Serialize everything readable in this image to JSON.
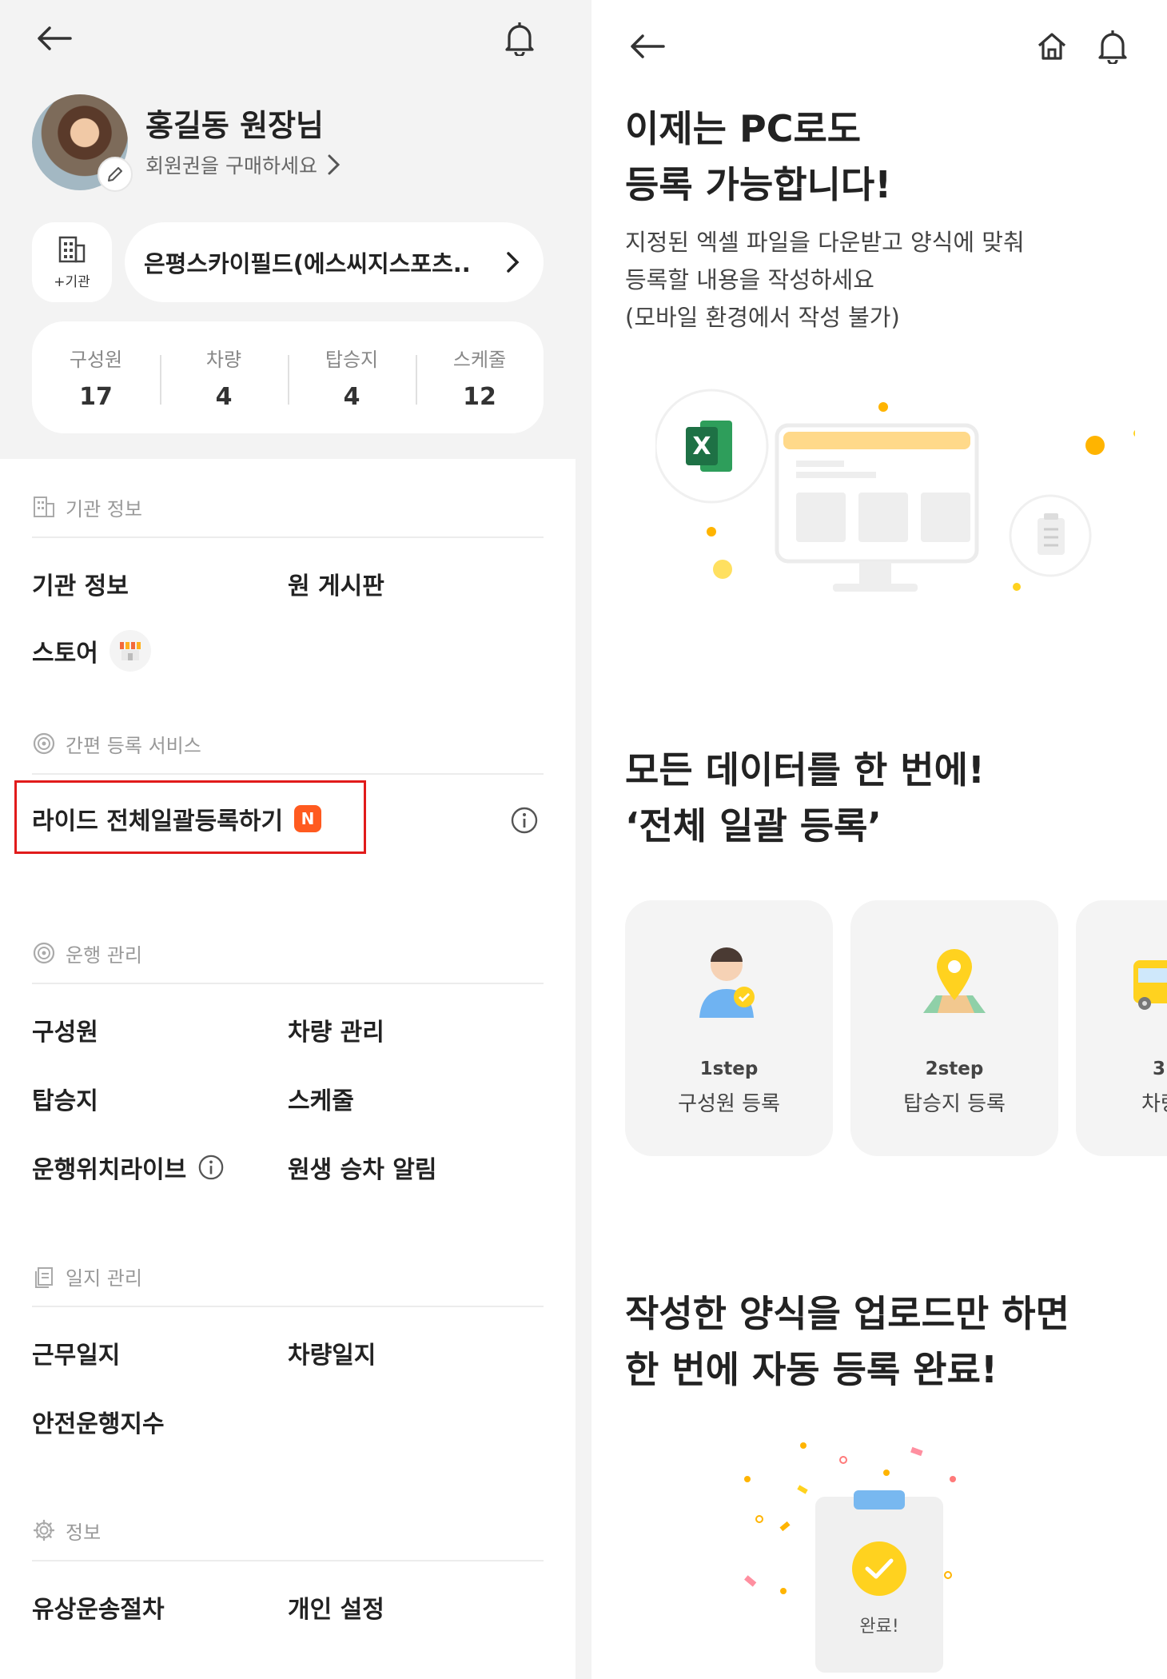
{
  "left": {
    "user": {
      "name": "홍길동 원장님",
      "subtitle": "회원권을 구매하세요"
    },
    "org": {
      "add_label": "+기관",
      "selected": "은평스카이필드(에스씨지스포츠.."
    },
    "stats": [
      {
        "label": "구성원",
        "value": "17"
      },
      {
        "label": "차량",
        "value": "4"
      },
      {
        "label": "탑승지",
        "value": "4"
      },
      {
        "label": "스케줄",
        "value": "12"
      }
    ],
    "sections": {
      "org_info": {
        "title": "기관 정보",
        "items": [
          "기관 정보",
          "원 게시판",
          "스토어"
        ]
      },
      "quick_register": {
        "title": "간편 등록 서비스",
        "item": "라이드 전체일괄등록하기",
        "badge": "N"
      },
      "operation": {
        "title": "운행 관리",
        "items": [
          "구성원",
          "차량 관리",
          "탑승지",
          "스케줄",
          "운행위치라이브",
          "원생 승차 알림"
        ]
      },
      "log": {
        "title": "일지 관리",
        "items": [
          "근무일지",
          "차량일지",
          "안전운행지수"
        ]
      },
      "info": {
        "title": "정보",
        "items": [
          "유상운송절차",
          "개인 설정"
        ]
      }
    }
  },
  "right": {
    "hero_title_1": "이제는 PC로도",
    "hero_title_2": "등록 가능합니다!",
    "desc_1": "지정된 엑셀 파일을 다운받고 양식에 맞춰",
    "desc_2": "등록할 내용을 작성하세요",
    "desc_3": "(모바일 환경에서 작성 불가)",
    "section2_title_1": "모든 데이터를 한 번에!",
    "section2_title_2": "‘전체 일괄 등록’",
    "steps": [
      {
        "num": "1step",
        "label": "구성원 등록"
      },
      {
        "num": "2step",
        "label": "탑승지 등록"
      },
      {
        "num": "3",
        "label": "차량"
      }
    ],
    "section3_title_1": "작성한 양식을 업로드만 하면",
    "section3_title_2": "한 번에 자동 등록 완료!",
    "done_label": "완료!"
  },
  "colors": {
    "highlight": "#e11b1b",
    "badge": "#ff5a1f",
    "accent_yellow": "#ffd21f",
    "excel_green": "#1e7145"
  }
}
